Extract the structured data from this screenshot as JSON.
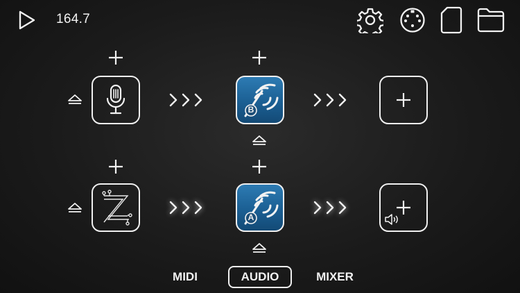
{
  "header": {
    "tempo": "164.7"
  },
  "icons": {
    "play": "play-icon",
    "settings": "gear-icon",
    "midi": "midi-connector-icon",
    "document": "document-icon",
    "folder": "folder-icon"
  },
  "channels": [
    {
      "input": "microphone-icon",
      "effect": "app-icon",
      "effect_badge": "B",
      "output": "empty-slot"
    },
    {
      "input": "z-circuit-icon",
      "effect": "app-icon",
      "effect_badge": "A",
      "output": "speaker-slot"
    }
  ],
  "tabs": [
    {
      "label": "MIDI",
      "active": false
    },
    {
      "label": "AUDIO",
      "active": true
    },
    {
      "label": "MIXER",
      "active": false
    }
  ],
  "colors": {
    "accent": "#f0f0f0",
    "app_blue": "#2d7bb3",
    "background": "#1b1b1b"
  }
}
